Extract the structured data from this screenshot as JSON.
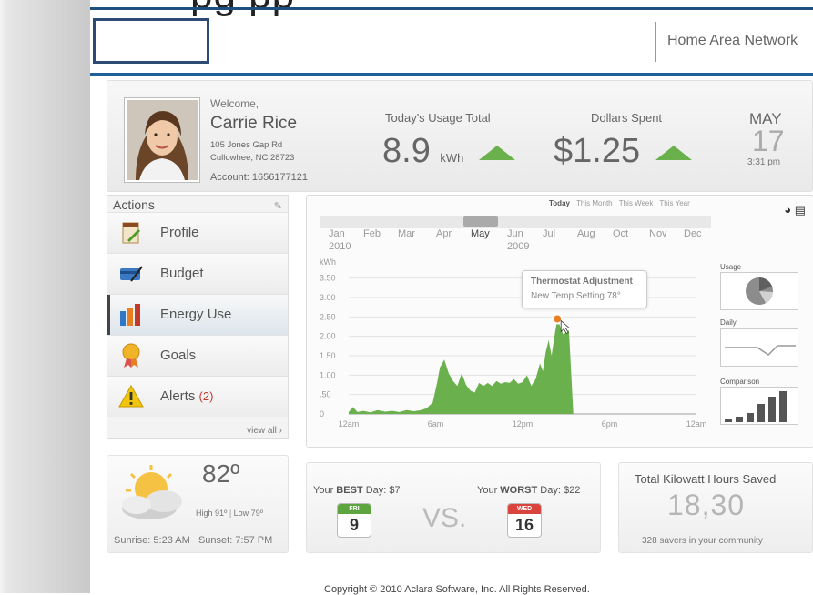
{
  "header": {
    "title_partial": "pg          pp",
    "network_label": "Home Area Network"
  },
  "user": {
    "welcome": "Welcome,",
    "name": "Carrie Rice",
    "address1": "105 Jones Gap Rd",
    "address2": "Cullowhee, NC 28723",
    "account": "Account: 1656177121"
  },
  "usage": {
    "label": "Today's Usage Total",
    "value": "8.9",
    "unit": "kWh"
  },
  "dollars": {
    "label": "Dollars Spent",
    "value": "$1.25"
  },
  "date": {
    "month": "MAY",
    "day": "17",
    "time": "3:31 pm"
  },
  "actions": {
    "title": "Actions",
    "items": [
      {
        "label": "Profile",
        "icon": "profile-icon"
      },
      {
        "label": "Budget",
        "icon": "budget-icon"
      },
      {
        "label": "Energy Use",
        "icon": "energy-use-icon"
      },
      {
        "label": "Goals",
        "icon": "goals-icon"
      },
      {
        "label": "Alerts",
        "count": "(2)",
        "icon": "alert-icon"
      }
    ],
    "view_all": "view all ›"
  },
  "chart_panel": {
    "period_tabs": [
      "Today",
      "This Month",
      "This Week",
      "This Year"
    ],
    "active_tab": "Today",
    "months": [
      "Jan",
      "Feb",
      "Mar",
      "Apr",
      "May",
      "Jun",
      "Jul",
      "Aug",
      "Oct",
      "Nov",
      "Dec"
    ],
    "selected_month": "May",
    "year_start": "2010",
    "year_end": "2009",
    "tooltip_title": "Thermostat Adjustment",
    "tooltip_sub": "New Temp Setting 78°",
    "side_labels": {
      "usage": "Usage",
      "daily": "Daily",
      "comparison": "Comparison"
    }
  },
  "chart_data": {
    "type": "area",
    "ylabel": "kWh",
    "ylim": [
      0,
      3.75
    ],
    "yticks": [
      "0",
      ".50",
      "1.00",
      "1.50",
      "2.00",
      "2.50",
      "3.00",
      "3.50"
    ],
    "xticks": [
      "12am",
      "6am",
      "12pm",
      "6pm",
      "12am"
    ],
    "x": [
      0,
      0.3,
      0.6,
      1,
      1.5,
      2,
      2.5,
      3,
      3.5,
      4,
      4.5,
      5,
      5.4,
      5.8,
      6.1,
      6.3,
      6.6,
      6.9,
      7.2,
      7.5,
      7.8,
      8.1,
      8.4,
      8.7,
      9,
      9.3,
      9.6,
      9.9,
      10.2,
      10.5,
      10.8,
      11.1,
      11.4,
      11.7,
      12,
      12.3,
      12.6,
      12.9,
      13.2,
      13.4,
      13.6,
      13.8,
      14,
      14.2,
      14.4,
      14.6,
      14.8,
      15,
      15.2,
      15.5
    ],
    "values": [
      0.05,
      0.18,
      0.05,
      0.08,
      0.04,
      0.1,
      0.06,
      0.08,
      0.05,
      0.1,
      0.07,
      0.1,
      0.15,
      0.3,
      0.8,
      1.2,
      1.4,
      1.05,
      0.85,
      0.72,
      1.05,
      0.75,
      0.6,
      0.55,
      0.8,
      0.72,
      0.8,
      0.72,
      0.85,
      0.78,
      0.82,
      0.8,
      0.9,
      0.78,
      0.82,
      1.0,
      0.72,
      0.9,
      1.3,
      1.1,
      1.6,
      1.9,
      1.5,
      2.0,
      2.45,
      2.25,
      2.05,
      2.1,
      2.15,
      0
    ]
  },
  "weather": {
    "temp": "82º",
    "high": "High 91º",
    "low": "Low 79º",
    "sunrise": "Sunrise: 5:23 AM",
    "sunset": "Sunset: 7:57 PM"
  },
  "versus": {
    "best_prefix": "Your ",
    "best_word": "BEST",
    "best_suffix": " Day: $7",
    "worst_prefix": "Your ",
    "worst_word": "WORST",
    "worst_suffix": " Day: $22",
    "vs": "VS.",
    "best_day": "FRI",
    "best_date": "9",
    "worst_day": "WED",
    "worst_date": "16"
  },
  "savings": {
    "title": "Total Kilowatt Hours Saved",
    "value": "18,30",
    "sub": "328 savers in your community"
  },
  "footer": {
    "copyright": "Copyright © 2010 Aclara Software, Inc. All Rights Reserved."
  },
  "colors": {
    "accent": "#1f5f9a",
    "chart_fill": "#6ab04c",
    "alert": "#c0392b"
  }
}
